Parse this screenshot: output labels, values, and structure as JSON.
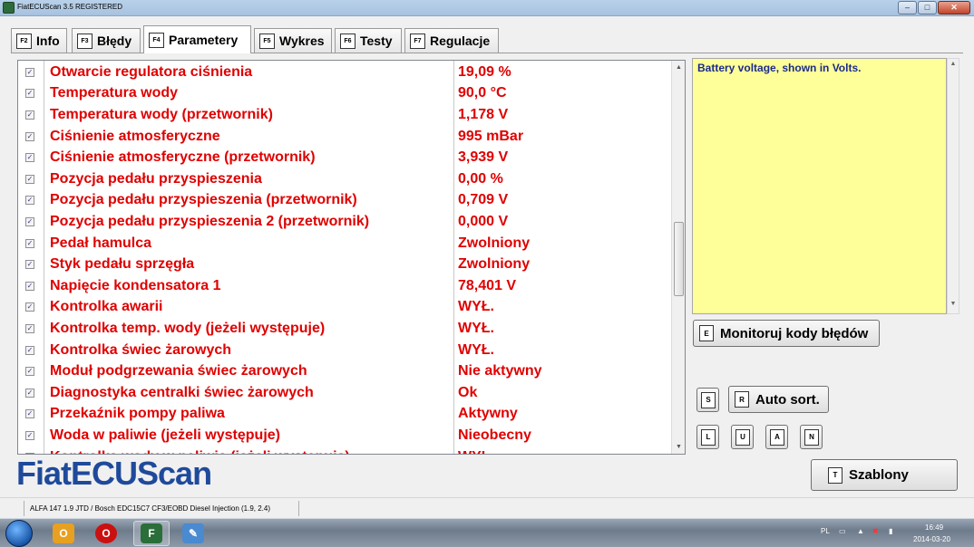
{
  "window": {
    "title": "FiatECUScan 3.5 REGISTERED",
    "min_glyph": "–",
    "max_glyph": "□",
    "close_glyph": "✕"
  },
  "tabs": [
    {
      "key": "F2",
      "label": "Info"
    },
    {
      "key": "F3",
      "label": "Błędy"
    },
    {
      "key": "F4",
      "label": "Parametery",
      "active": true
    },
    {
      "key": "F5",
      "label": "Wykres"
    },
    {
      "key": "F6",
      "label": "Testy"
    },
    {
      "key": "F7",
      "label": "Regulacje"
    }
  ],
  "parameters": [
    {
      "name": "Otwarcie regulatora ciśnienia",
      "value": "19,09 %",
      "checked": true
    },
    {
      "name": "Temperatura wody",
      "value": "90,0 °C",
      "checked": true
    },
    {
      "name": "Temperatura wody (przetwornik)",
      "value": "1,178 V",
      "checked": true
    },
    {
      "name": "Ciśnienie atmosferyczne",
      "value": "995 mBar",
      "checked": true
    },
    {
      "name": "Ciśnienie atmosferyczne (przetwornik)",
      "value": "3,939 V",
      "checked": true
    },
    {
      "name": "Pozycja pedału przyspieszenia",
      "value": "0,00 %",
      "checked": true
    },
    {
      "name": "Pozycja pedału przyspieszenia (przetwornik)",
      "value": "0,709 V",
      "checked": true
    },
    {
      "name": "Pozycja pedału przyspieszenia 2 (przetwornik)",
      "value": "0,000 V",
      "checked": true
    },
    {
      "name": "Pedał hamulca",
      "value": "Zwolniony",
      "checked": true
    },
    {
      "name": "Styk pedału sprzęgła",
      "value": "Zwolniony",
      "checked": true
    },
    {
      "name": "Napięcie kondensatora 1",
      "value": "78,401 V",
      "checked": true
    },
    {
      "name": "Kontrolka awarii",
      "value": "WYŁ.",
      "checked": true
    },
    {
      "name": "Kontrolka temp. wody (jeżeli występuje)",
      "value": "WYŁ.",
      "checked": true
    },
    {
      "name": "Kontrolka świec żarowych",
      "value": "WYŁ.",
      "checked": true
    },
    {
      "name": "Moduł podgrzewania świec żarowych",
      "value": "Nie aktywny",
      "checked": true
    },
    {
      "name": "Diagnostyka centralki świec żarowych",
      "value": "Ok",
      "checked": true
    },
    {
      "name": "Przekaźnik pompy paliwa",
      "value": "Aktywny",
      "checked": true
    },
    {
      "name": "Woda w paliwie (jeżeli występuje)",
      "value": "Nieobecny",
      "checked": true
    },
    {
      "name": "Kontrolka wody w paliwie (jeżeli występuje)",
      "value": "WYŁ.",
      "checked": true
    }
  ],
  "description": "Battery voltage, shown in Volts.",
  "buttons": {
    "monitor": {
      "key": "E",
      "label": "Monitoruj kody błędów"
    },
    "s": {
      "key": "S"
    },
    "autosort": {
      "key": "R",
      "label": "Auto sort."
    },
    "l": {
      "key": "L"
    },
    "u": {
      "key": "U"
    },
    "a": {
      "key": "A"
    },
    "n": {
      "key": "N"
    },
    "templates": {
      "key": "T",
      "label": "Szablony"
    }
  },
  "logo": "FiatECUScan",
  "statusbar": {
    "text": "ALFA 147 1.9 JTD / Bosch EDC15C7 CF3/EOBD Diesel Injection (1.9, 2.4)"
  },
  "taskbar": {
    "language": "PL",
    "time": "16:49",
    "date": "2014-03-20",
    "items": [
      {
        "icon": "windows-start-icon"
      },
      {
        "icon": "outlook-icon",
        "color": "#e8a020"
      },
      {
        "icon": "opera-icon",
        "color": "#cc1010"
      },
      {
        "icon": "fiatecuscan-icon",
        "color": "#2a6e3a",
        "active": true
      },
      {
        "icon": "paint-icon",
        "color": "#4a8ad0"
      }
    ]
  },
  "colors": {
    "param_text": "#e00000",
    "description_bg": "#ffff99",
    "description_text": "#1b2b8a",
    "logo": "#1f4a9b"
  }
}
